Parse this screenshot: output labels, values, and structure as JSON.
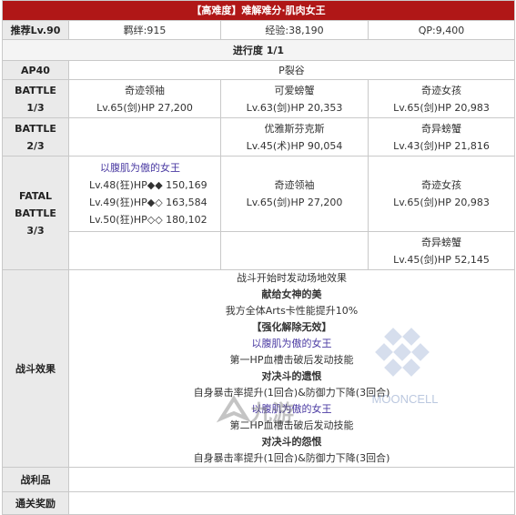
{
  "header": {
    "title": "【高难度】难解难分·肌肉女王"
  },
  "info": {
    "recommend": "推荐Lv.90",
    "bond": "羁绊:915",
    "exp": "经验:38,190",
    "qp": "QP:9,400"
  },
  "progress": "进行度 1/1",
  "ap": {
    "label": "AP40",
    "location": "P裂谷"
  },
  "battle1": {
    "label": [
      "BATTLE",
      "1/3"
    ],
    "enemies": [
      {
        "name": "奇迹领袖",
        "stats": "Lv.65(剑)HP 27,200"
      },
      {
        "name": "可爱螃蟹",
        "stats": "Lv.63(剑)HP 20,353"
      },
      {
        "name": "奇迹女孩",
        "stats": "Lv.65(剑)HP 20,983"
      }
    ]
  },
  "battle2": {
    "label": [
      "BATTLE",
      "2/3"
    ],
    "enemies": [
      {
        "name": "优雅斯芬克斯",
        "stats": "Lv.45(术)HP 90,054"
      },
      {
        "name": "奇异螃蟹",
        "stats": "Lv.43(剑)HP 21,816"
      }
    ]
  },
  "battle3": {
    "label": [
      "FATAL",
      "BATTLE",
      "3/3"
    ],
    "boss": {
      "name": "以腹肌为傲的女王",
      "lines": [
        "Lv.48(狂)HP◆◆ 150,169",
        "Lv.49(狂)HP◆◇ 163,584",
        "Lv.50(狂)HP◇◇ 180,102"
      ]
    },
    "enemies": [
      {
        "name": "奇迹领袖",
        "stats": "Lv.65(剑)HP 27,200"
      },
      {
        "name": "奇迹女孩",
        "stats": "Lv.65(剑)HP 20,983"
      },
      {
        "name": "奇异螃蟹",
        "stats": "Lv.45(剑)HP 52,145"
      }
    ]
  },
  "effects": {
    "label": "战斗效果",
    "line1": {
      "pre": "战斗开始时发动场地效果",
      "bold": "献给女神的美"
    },
    "line2": {
      "pre": "我方全体Arts卡性能提升10%",
      "bold": "【强化解除无效】"
    },
    "line3": {
      "purple": "以腹肌为傲的女王",
      "pre": " 第一HP血槽击破后发动技能",
      "bold": "对决斗的遗恨"
    },
    "line4": "自身暴击率提升(1回合)&防御力下降(3回合)",
    "line5": {
      "purple": "以腹肌为傲的女王",
      "pre": " 第二HP血槽击破后发动技能",
      "bold": "对决斗的怨恨"
    },
    "line6": "自身暴击率提升(1回合)&防御力下降(3回合)"
  },
  "drops": {
    "label": "战利品"
  },
  "reward": {
    "label": "通关奖励"
  },
  "watermarks": {
    "mooncell": "MOONCELL",
    "jiuyou": "九游"
  },
  "colors": {
    "title_bg": "#b01717",
    "label_bg": "#eaeaea",
    "purple": "#4a3aa2"
  }
}
